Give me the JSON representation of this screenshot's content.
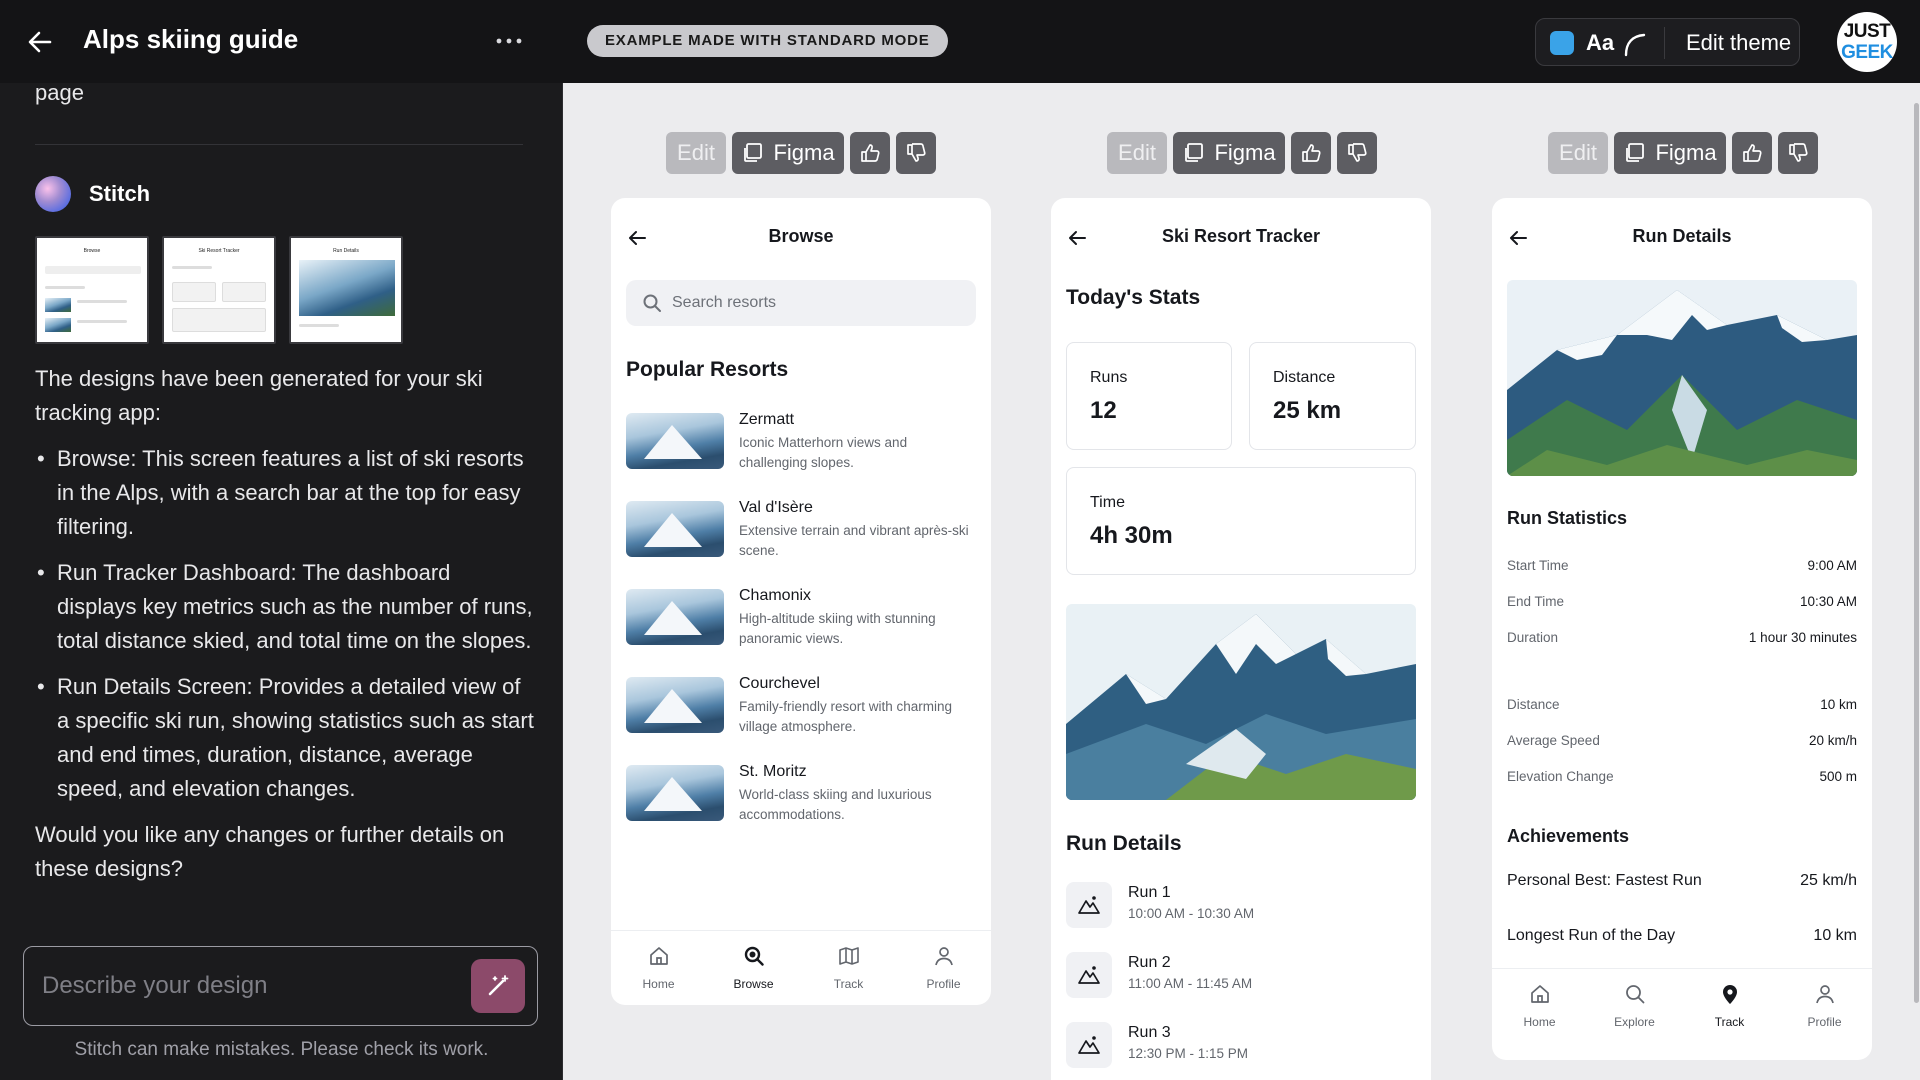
{
  "chat": {
    "title": "Alps skiing guide",
    "scrolled_text": "page",
    "agent_name": "Stitch",
    "thumbnails": [
      {
        "title": "Browse"
      },
      {
        "title": "Ski Resort Tracker"
      },
      {
        "title": "Run Details"
      }
    ],
    "intro": "The designs have been generated for your ski tracking app:",
    "bullets": [
      "Browse: This screen features a list of ski resorts in the Alps, with a search bar at the top for easy filtering.",
      "Run Tracker Dashboard: The dashboard displays key metrics such as the number of runs, total distance skied, and total time on the slopes.",
      "Run Details Screen: Provides a detailed view of a specific ski run, showing statistics such as start and end times, duration, distance, average speed, and elevation changes."
    ],
    "followup": "Would you like any changes or further details on these designs?",
    "input_placeholder": "Describe your design",
    "disclaimer": "Stitch can make mistakes. Please check its work."
  },
  "topbar": {
    "example_pill": "EXAMPLE MADE WITH STANDARD MODE",
    "theme_font_label": "Aa",
    "edit_theme": "Edit theme",
    "theme_color": "#3aa3e8",
    "avatar_line1": "JUST",
    "avatar_line2": "GEEK"
  },
  "toolbar": {
    "edit": "Edit",
    "figma": "Figma",
    "thumbs_up_icon": "thumbs-up-icon",
    "thumbs_down_icon": "thumbs-down-icon"
  },
  "browse": {
    "title": "Browse",
    "search_placeholder": "Search resorts",
    "section": "Popular Resorts",
    "resorts": [
      {
        "name": "Zermatt",
        "desc": "Iconic Matterhorn views and challenging slopes."
      },
      {
        "name": "Val d'Isère",
        "desc": "Extensive terrain and vibrant après-ski scene."
      },
      {
        "name": "Chamonix",
        "desc": "High-altitude skiing with stunning panoramic views."
      },
      {
        "name": "Courchevel",
        "desc": "Family-friendly resort with charming village atmosphere."
      },
      {
        "name": "St. Moritz",
        "desc": "World-class skiing and luxurious accommodations."
      }
    ],
    "nav": [
      "Home",
      "Browse",
      "Track",
      "Profile"
    ],
    "nav_active": "Browse"
  },
  "tracker": {
    "title": "Ski Resort Tracker",
    "stats_heading": "Today's Stats",
    "runs_label": "Runs",
    "runs_value": "12",
    "distance_label": "Distance",
    "distance_value": "25 km",
    "time_label": "Time",
    "time_value": "4h 30m",
    "run_details_heading": "Run Details",
    "runs": [
      {
        "name": "Run 1",
        "time": "10:00 AM - 10:30 AM"
      },
      {
        "name": "Run 2",
        "time": "11:00 AM - 11:45 AM"
      },
      {
        "name": "Run 3",
        "time": "12:30 PM - 1:15 PM"
      }
    ]
  },
  "details": {
    "title": "Run Details",
    "stats_heading": "Run Statistics",
    "stats": [
      {
        "k": "Start Time",
        "v": "9:00 AM"
      },
      {
        "k": "End Time",
        "v": "10:30 AM"
      },
      {
        "k": "Duration",
        "v": "1 hour 30 minutes"
      },
      {
        "k": "Distance",
        "v": "10 km"
      },
      {
        "k": "Average Speed",
        "v": "20 km/h"
      },
      {
        "k": "Elevation Change",
        "v": "500 m"
      }
    ],
    "achievements_heading": "Achievements",
    "achievements": [
      {
        "k": "Personal Best: Fastest Run",
        "v": "25 km/h"
      },
      {
        "k": "Longest Run of the Day",
        "v": "10 km"
      }
    ],
    "nav": [
      "Home",
      "Explore",
      "Track",
      "Profile"
    ],
    "nav_active": "Track"
  }
}
